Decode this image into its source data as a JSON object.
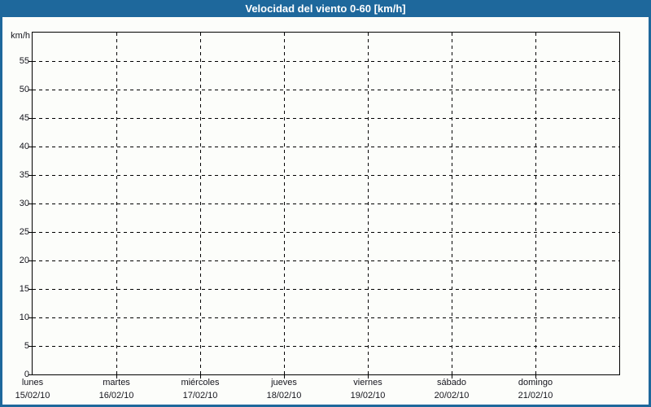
{
  "window": {
    "title": "Velocidad del viento 0-60 [km/h]"
  },
  "colors": {
    "titlebar_bg": "#1e689c",
    "window_border": "#1e689c",
    "page_bg": "#fcfdfa",
    "grid": "#000000",
    "axis": "#000000",
    "label_text": "#15151d",
    "title_text": "#ffffff"
  },
  "chart_data": {
    "type": "line",
    "title": "Velocidad del viento 0-60 [km/h]",
    "ylabel": "km/h",
    "ylim": [
      0,
      60
    ],
    "yticks": [
      0,
      5,
      10,
      15,
      20,
      25,
      30,
      35,
      40,
      45,
      50,
      55
    ],
    "x_categories": [
      {
        "day": "lunes",
        "date": "15/02/10"
      },
      {
        "day": "martes",
        "date": "16/02/10"
      },
      {
        "day": "miércoles",
        "date": "17/02/10"
      },
      {
        "day": "jueves",
        "date": "18/02/10"
      },
      {
        "day": "viernes",
        "date": "19/02/10"
      },
      {
        "day": "sábado",
        "date": "20/02/10"
      },
      {
        "day": "domingo",
        "date": "21/02/10"
      }
    ],
    "series": [],
    "grid": "dashed; horizontal line every 5 km/h, vertical line at each day boundary",
    "legend": "none"
  }
}
